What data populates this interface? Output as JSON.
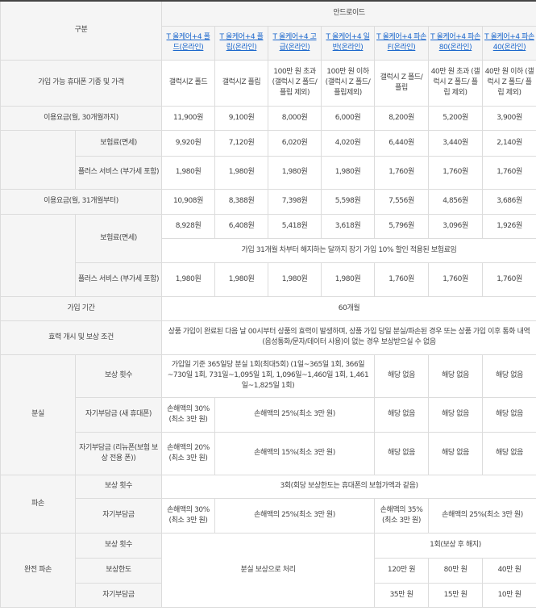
{
  "header": {
    "category": "구분",
    "android": "안드로이드",
    "products": [
      "T 올케어+4 폴드(온라인)",
      "T 올케어+4 플립(온라인)",
      "T 올케어+4 고급(온라인)",
      "T 올케어+4 일반(온라인)",
      "T 올케어+4 파손F(온라인)",
      "T 올케어+4 파손80(온라인)",
      "T 올케어+4 파손40(온라인)"
    ]
  },
  "devices": {
    "label": "가입 가능 휴대폰 기종 및 가격",
    "values": [
      "갤럭시Z 폴드",
      "갤럭시Z 플립",
      "100만 원 초과 (갤럭시 Z 폴드/ 플립 제외)",
      "100만 원 이하 (갤럭시 Z 폴드/ 플립제외)",
      "갤럭시 Z 폴드/ 플립",
      "40만 원 초과 (갤럭시 Z 폴드/ 플립 제외)",
      "40만 원 이하 (갤럭시 Z 폴드/ 플립 제외)"
    ]
  },
  "fee30": {
    "label": "이용요금(월, 30개월까지)",
    "values": [
      "11,900원",
      "9,100원",
      "8,000원",
      "6,000원",
      "8,200원",
      "5,200원",
      "3,900원"
    ],
    "insurance_label": "보험료(면세)",
    "insurance": [
      "9,920원",
      "7,120원",
      "6,020원",
      "4,020원",
      "6,440원",
      "3,440원",
      "2,140원"
    ],
    "plus_label": "플러스 서비스 (부가세 포함)",
    "plus": [
      "1,980원",
      "1,980원",
      "1,980원",
      "1,980원",
      "1,760원",
      "1,760원",
      "1,760원"
    ]
  },
  "fee31": {
    "label": "이용요금(월, 31개월부터)",
    "values": [
      "10,908원",
      "8,388원",
      "7,398원",
      "5,598원",
      "7,556원",
      "4,856원",
      "3,686원"
    ],
    "insurance_label": "보험료(면세)",
    "insurance": [
      "8,928원",
      "6,408원",
      "5,418원",
      "3,618원",
      "5,796원",
      "3,096원",
      "1,926원"
    ],
    "insurance_note": "가입 31개월 차부터 해지하는 달까지 장기 가입 10% 할인 적용된 보험료임",
    "plus_label": "플러스 서비스 (부가세 포함)",
    "plus": [
      "1,980원",
      "1,980원",
      "1,980원",
      "1,980원",
      "1,760원",
      "1,760원",
      "1,760원"
    ]
  },
  "period": {
    "label": "가입 기간",
    "value": "60개월"
  },
  "effect": {
    "label": "효력 개시 및 보상 조건",
    "value": "상품 가입이 완료된 다음 날 00시부터 상품의 효력이 발생하며, 상품 가입 당일 분실/파손된 경우 또는 상품 가입 이후 통화 내역(음성통화/문자/데이터 사용)이 없는 경우 보상받으실 수 없음"
  },
  "loss": {
    "label": "분실",
    "count_label": "보상 횟수",
    "count_value": "가입일 기준 365일당 분실 1회(최대5회) (1일~365일 1회, 366일~730일 1회, 731일~1,095일 1회, 1,096일~1,460일 1회, 1,461일~1,825일 1회)",
    "none": "해당 없음",
    "deduct_new_label": "자기부담금 (새 휴대폰)",
    "deduct_new_first": "손해액의 30% (최소 3만 원)",
    "deduct_new_rest": "손해액의 25%(최소 3만 원)",
    "deduct_renew_label": "자기부담금 (리뉴폰(보험 보상 전용 폰))",
    "deduct_renew_first": "손해액의 20% (최소 3만 원)",
    "deduct_renew_rest": "손해액의 15%(최소 3만 원)"
  },
  "damage": {
    "label": "파손",
    "count_label": "보상 횟수",
    "count_value": "3회(회당 보상한도는 휴대폰의 보험가액과 같음)",
    "deduct_label": "자기부담금",
    "deduct_first": "손해액의 30% (최소 3만 원)",
    "deduct_mid": "손해액의 25%(최소 3만 원)",
    "deduct_f": "손해액의 35% (최소 3만 원)",
    "deduct_last": "손해액의 25%(최소 3만 원)"
  },
  "total": {
    "label": "완전 파손",
    "count_label": "보상 횟수",
    "limit_label": "보상한도",
    "deduct_label": "자기부담금",
    "loss_note": "분실 보상으로 처리",
    "count_value": "1회(보상 후 해지)",
    "limits": [
      "120만 원",
      "80만 원",
      "40만 원"
    ],
    "deducts": [
      "35만 원",
      "15만 원",
      "10만 원"
    ]
  }
}
